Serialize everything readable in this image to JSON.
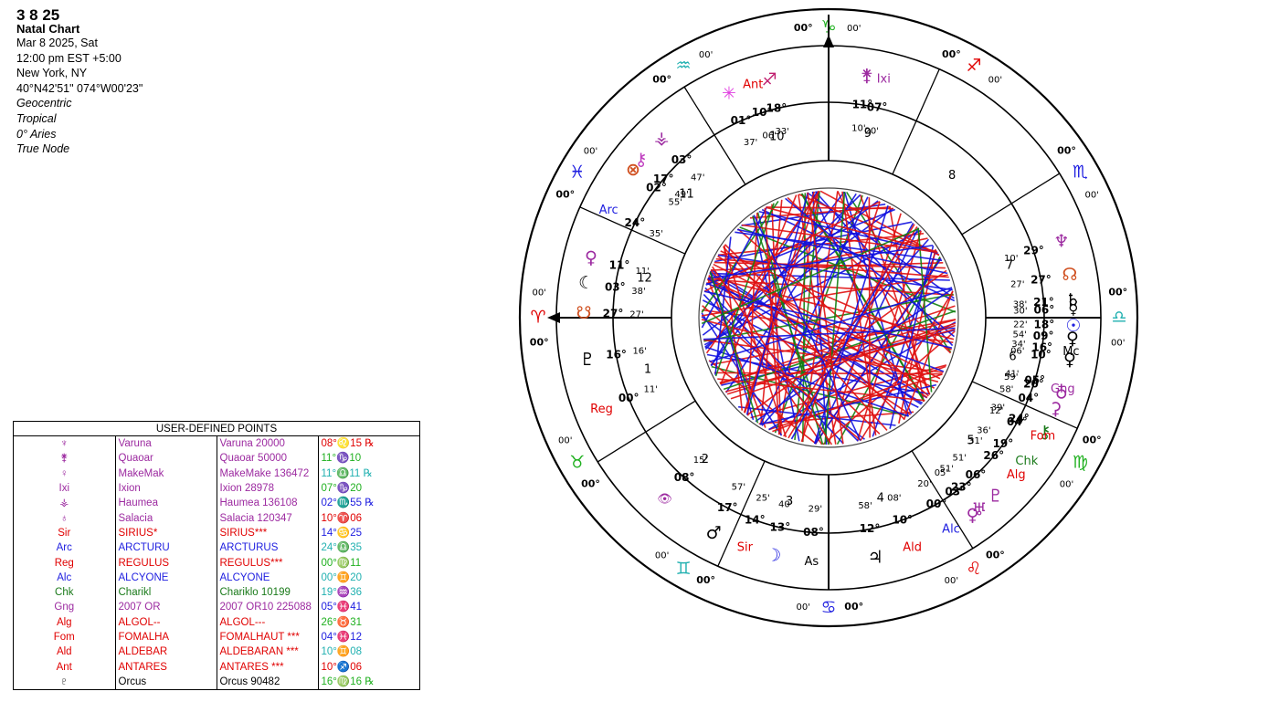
{
  "header": {
    "title": "3 8 25",
    "subtitle": "Natal Chart",
    "date": "Mar 8 2025, Sat",
    "time": "12:00 pm  EST +5:00",
    "place": "New York, NY",
    "coords": "40°N42'51\" 074°W00'23\"",
    "system1": "Geocentric",
    "system2": "Tropical",
    "system3": "0° Aries",
    "system4": "True Node"
  },
  "udp": {
    "title": "USER-DEFINED POINTS",
    "rows": [
      {
        "sym": "♆",
        "name": "Varuna",
        "full": "Varuna 20000",
        "pos": "08°♌15 ℞",
        "c1": "#9c2aa0",
        "c2": "#e00000"
      },
      {
        "sym": "⚵",
        "name": "Quaoar",
        "full": "Quaoar 50000",
        "pos": "11°♑10",
        "c1": "#9c2aa0",
        "c2": "#20b020"
      },
      {
        "sym": "♀",
        "name": "MakeMak",
        "full": "MakeMake 136472",
        "pos": "11°♎11 ℞",
        "c1": "#9c2aa0",
        "c2": "#20b0b0"
      },
      {
        "sym": "Ixi",
        "name": "Ixion",
        "full": "Ixion 28978",
        "pos": "07°♑20",
        "c1": "#9c2aa0",
        "c2": "#20b020"
      },
      {
        "sym": "⚶",
        "name": "Haumea",
        "full": "Haumea 136108",
        "pos": "02°♏55 ℞",
        "c1": "#9c2aa0",
        "c2": "#2020e0"
      },
      {
        "sym": "♁",
        "name": "Salacia",
        "full": "Salacia 120347",
        "pos": "10°♈06",
        "c1": "#9c2aa0",
        "c2": "#e00000"
      },
      {
        "sym": "Sir",
        "name": "SIRIUS*",
        "full": "SIRIUS***",
        "pos": "14°♋25",
        "c1": "#e00000",
        "c2": "#2020e0"
      },
      {
        "sym": "Arc",
        "name": "ARCTURU",
        "full": "ARCTURUS",
        "pos": "24°♎35",
        "c1": "#2020e0",
        "c2": "#20b0b0"
      },
      {
        "sym": "Reg",
        "name": "REGULUS",
        "full": "REGULUS***",
        "pos": "00°♍11",
        "c1": "#e00000",
        "c2": "#20b020"
      },
      {
        "sym": "Alc",
        "name": "ALCYONE",
        "full": "ALCYONE",
        "pos": "00°♊20",
        "c1": "#2020e0",
        "c2": "#20b0b0"
      },
      {
        "sym": "Chk",
        "name": "Charikl",
        "full": "Chariklo 10199",
        "pos": "19°♒36",
        "c1": "#1a7a1a",
        "c2": "#20b0b0"
      },
      {
        "sym": "Gng",
        "name": "2007 OR",
        "full": "2007 OR10 225088",
        "pos": "05°♓41",
        "c1": "#9c2aa0",
        "c2": "#2020e0"
      },
      {
        "sym": "Alg",
        "name": "ALGOL--",
        "full": "ALGOL---",
        "pos": "26°♉31",
        "c1": "#e00000",
        "c2": "#20b020"
      },
      {
        "sym": "Fom",
        "name": "FOMALHA",
        "full": "FOMALHAUT ***",
        "pos": "04°♓12",
        "c1": "#e00000",
        "c2": "#2020e0"
      },
      {
        "sym": "Ald",
        "name": "ALDEBAR",
        "full": "ALDEBARAN ***",
        "pos": "10°♊08",
        "c1": "#e00000",
        "c2": "#20b0b0"
      },
      {
        "sym": "Ant",
        "name": "ANTARES",
        "full": "ANTARES ***",
        "pos": "10°♐06",
        "c1": "#e00000",
        "c2": "#e00000"
      },
      {
        "sym": "♇",
        "name": "Orcus",
        "full": "Orcus 90482",
        "pos": "16°♍16 ℞",
        "c1": "#000000",
        "c2": "#20b020"
      }
    ]
  },
  "wheel": {
    "house_numbers": [
      "1",
      "2",
      "3",
      "4",
      "5",
      "6",
      "7",
      "8",
      "9",
      "10",
      "11",
      "12"
    ],
    "sign_zero": "00°",
    "sign_zero2": "00'",
    "signs": [
      {
        "glyph": "♈",
        "color": "#e00000"
      },
      {
        "glyph": "♉",
        "color": "#20b020"
      },
      {
        "glyph": "♊",
        "color": "#20b0b0"
      },
      {
        "glyph": "♋",
        "color": "#2020e0"
      },
      {
        "glyph": "♌",
        "color": "#e00000"
      },
      {
        "glyph": "♍",
        "color": "#20b020"
      },
      {
        "glyph": "♎",
        "color": "#20b0b0"
      },
      {
        "glyph": "♏",
        "color": "#2020e0"
      },
      {
        "glyph": "♐",
        "color": "#e00000"
      },
      {
        "glyph": "♑",
        "color": "#20b020"
      },
      {
        "glyph": "♒",
        "color": "#20b0b0"
      },
      {
        "glyph": "♓",
        "color": "#2020e0"
      }
    ],
    "cusps": [
      {
        "deg": "00°",
        "sign": "♑",
        "min": "00'",
        "color": "#20b020"
      },
      {
        "deg": "24°",
        "sign": "♎",
        "min": "35'",
        "color": "#20b0b0"
      },
      {
        "deg": "00°",
        "sign": "♋",
        "min": "00'",
        "color": "#2020e0"
      }
    ],
    "bodies": [
      {
        "label": "Ixi",
        "deg": "07°",
        "min": "20'",
        "sign": "♑",
        "color": "#9c2aa0"
      },
      {
        "label": "⚵",
        "deg": "11°",
        "min": "10'",
        "sign": "♑",
        "color": "#9c2aa0"
      },
      {
        "label": "Ant",
        "deg": "10°",
        "min": "06'",
        "sign": "♐",
        "color": "#e00000"
      },
      {
        "label": "♐",
        "deg": "18°",
        "min": "33'",
        "sign": "♐",
        "color": "#c02070"
      },
      {
        "label": "✳",
        "deg": "01°",
        "min": "37'",
        "sign": "♐",
        "color": "#e040e0"
      },
      {
        "label": "⚶",
        "deg": "03°",
        "min": "47'",
        "sign": "♏",
        "color": "#9c2aa0"
      },
      {
        "label": "⚷",
        "deg": "17°",
        "min": "49'",
        "sign": "♏",
        "color": "#c040c0"
      },
      {
        "label": "⊗",
        "deg": "02°",
        "min": "55'",
        "sign": "♏",
        "color": "#d05020"
      },
      {
        "label": "Arc",
        "deg": "24°",
        "min": "35'",
        "sign": "♎",
        "color": "#2020e0"
      },
      {
        "label": "♀",
        "deg": "11°",
        "min": "11'",
        "sign": "♎",
        "color": "#9c2aa0"
      },
      {
        "label": "☾",
        "deg": "03°",
        "min": "38'",
        "sign": "♎",
        "color": "#000000"
      },
      {
        "label": "☋",
        "deg": "27°",
        "min": "27'",
        "sign": "♍",
        "color": "#d05020"
      },
      {
        "label": "♇",
        "deg": "16°",
        "min": "16'",
        "sign": "♍",
        "color": "#000000"
      },
      {
        "label": "Reg",
        "deg": "00°",
        "min": "11'",
        "sign": "♍",
        "color": "#e00000"
      },
      {
        "label": "👁",
        "deg": "08°",
        "min": "15'",
        "sign": "♌",
        "color": "#9c2aa0"
      },
      {
        "label": "♂",
        "deg": "17°",
        "min": "57'",
        "sign": "♋",
        "color": "#000000"
      },
      {
        "label": "Sir",
        "deg": "14°",
        "min": "25'",
        "sign": "♋",
        "color": "#e00000"
      },
      {
        "label": "☽",
        "deg": "13°",
        "min": "40'",
        "sign": "♋",
        "color": "#2020e0"
      },
      {
        "label": "As",
        "deg": "08°",
        "min": "29'",
        "sign": "♋",
        "color": "#000000"
      },
      {
        "label": "♃",
        "deg": "12°",
        "min": "58'",
        "sign": "♊",
        "color": "#000000"
      },
      {
        "label": "Ald",
        "deg": "10°",
        "min": "08'",
        "sign": "♊",
        "color": "#e00000"
      },
      {
        "label": "Alc",
        "deg": "00°",
        "min": "20'",
        "sign": "♊",
        "color": "#2020e0"
      },
      {
        "label": "♅",
        "deg": "23°",
        "min": "51'",
        "sign": "♉",
        "color": "#9c2aa0"
      },
      {
        "label": "Alg",
        "deg": "26°",
        "min": "31'",
        "sign": "♉",
        "color": "#e00000"
      },
      {
        "label": "⚷",
        "deg": "24°",
        "min": "39'",
        "sign": "♈",
        "color": "#1a7a1a"
      },
      {
        "label": "♁",
        "deg": "20°",
        "min": "59'",
        "sign": "♈",
        "color": "#9c2aa0"
      },
      {
        "label": "♀",
        "deg": "10°",
        "min": "06'",
        "sign": "♈",
        "color": "#000000"
      },
      {
        "label": "♀",
        "deg": "09°",
        "min": "54'",
        "sign": "♈",
        "color": "#000000"
      },
      {
        "label": "☿",
        "deg": "06°",
        "min": "30'",
        "sign": "♈",
        "color": "#000000"
      },
      {
        "label": "♆",
        "deg": "29°",
        "min": "10'",
        "sign": "♓",
        "color": "#9c2aa0"
      },
      {
        "label": "☊",
        "deg": "27°",
        "min": "27'",
        "sign": "♓",
        "color": "#d05020"
      },
      {
        "label": "♄",
        "deg": "21°",
        "min": "38'",
        "sign": "♓",
        "color": "#000000"
      },
      {
        "label": "☉",
        "deg": "18°",
        "min": "22'",
        "sign": "♓",
        "color": "#2020e0"
      },
      {
        "label": "Mc",
        "deg": "16°",
        "min": "34'",
        "sign": "♓",
        "color": "#000000"
      },
      {
        "label": "Gng",
        "deg": "05°",
        "min": "41'",
        "sign": "♓",
        "color": "#9c2aa0"
      },
      {
        "label": "⚳",
        "deg": "04°",
        "min": "58'",
        "sign": "♓",
        "color": "#9c2aa0"
      },
      {
        "label": "Fom",
        "deg": "04°",
        "min": "12'",
        "sign": "♓",
        "color": "#e00000"
      },
      {
        "label": "Chk",
        "deg": "19°",
        "min": "36'",
        "sign": "♒",
        "color": "#1a7a1a"
      },
      {
        "label": "♇",
        "deg": "06°",
        "min": "51'",
        "sign": "♒",
        "color": "#9c2aa0"
      },
      {
        "label": "♀",
        "deg": "03°",
        "min": "05'",
        "sign": "♒",
        "color": "#9c2aa0"
      }
    ],
    "aspect_colors": {
      "red": "#e01010",
      "blue": "#1010e0",
      "green": "#108010"
    }
  }
}
